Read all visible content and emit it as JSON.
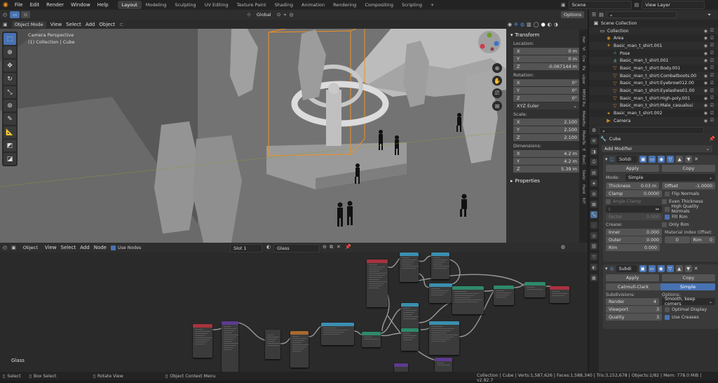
{
  "topbar": {
    "menus": [
      "File",
      "Edit",
      "Render",
      "Window",
      "Help"
    ],
    "workspaces": [
      "Layout",
      "Modeling",
      "Sculpting",
      "UV Editing",
      "Texture Paint",
      "Shading",
      "Animation",
      "Rendering",
      "Compositing",
      "Scripting"
    ],
    "active_workspace": "Layout",
    "add_tab": "+",
    "scene": "Scene",
    "view_layer": "View Layer"
  },
  "viewport_header": {
    "mode": "Object Mode",
    "menus": [
      "View",
      "Select",
      "Add",
      "Object"
    ],
    "transform_orientation": "Global",
    "options": "Options"
  },
  "viewport": {
    "camera_label": "Camera Perspective",
    "collection_label": "(1) Collection | Cube"
  },
  "n_panel": {
    "section": "Transform",
    "location_label": "Location:",
    "location": [
      {
        "axis": "X",
        "value": "0 m"
      },
      {
        "axis": "Y",
        "value": "0 m"
      },
      {
        "axis": "Z",
        "value": "-0.067144 m"
      }
    ],
    "rotation_label": "Rotation:",
    "rotation": [
      {
        "axis": "X",
        "value": "0°"
      },
      {
        "axis": "Y",
        "value": "0°"
      },
      {
        "axis": "Z",
        "value": "0°"
      }
    ],
    "rotation_mode": "XYZ Euler",
    "scale_label": "Scale:",
    "scale": [
      {
        "axis": "X",
        "value": "2.100"
      },
      {
        "axis": "Y",
        "value": "2.100"
      },
      {
        "axis": "Z",
        "value": "2.100"
      }
    ],
    "dimensions_label": "Dimensions:",
    "dimensions": [
      {
        "axis": "X",
        "value": "4.2 m"
      },
      {
        "axis": "Y",
        "value": "4.2 m"
      },
      {
        "axis": "Z",
        "value": "5.39 m"
      }
    ],
    "properties": "Properties",
    "vertical_tabs": [
      "Iter",
      "Vi",
      "Cre",
      "Pa",
      "ulpor",
      "MHX2 Ru",
      "MakeHu",
      "MakeTa",
      "E",
      "BoxC",
      "Sketc",
      "Hard",
      "KIT"
    ]
  },
  "outliner": {
    "rows": [
      {
        "name": "Scene Collection",
        "indent": 0,
        "icon": "scene-collection-icon"
      },
      {
        "name": "Collection",
        "indent": 1,
        "icon": "collection-icon"
      },
      {
        "name": "Area",
        "indent": 2,
        "icon": "light-icon"
      },
      {
        "name": "Basic_man_t_shirt.001",
        "indent": 2,
        "icon": "armature-icon"
      },
      {
        "name": "Pose",
        "indent": 3,
        "icon": "pose-icon"
      },
      {
        "name": "Basic_man_t_shirt.001",
        "indent": 3,
        "icon": "armature-data-icon"
      },
      {
        "name": "Basic_man_t_shirt:Body.001",
        "indent": 3,
        "icon": "mesh-icon"
      },
      {
        "name": "Basic_man_t_shirt:Combatboots.00",
        "indent": 3,
        "icon": "mesh-icon"
      },
      {
        "name": "Basic_man_t_shirt:Eyebrow012.00",
        "indent": 3,
        "icon": "mesh-icon"
      },
      {
        "name": "Basic_man_t_shirt:Eyelashes01.00",
        "indent": 3,
        "icon": "mesh-icon"
      },
      {
        "name": "Basic_man_t_shirt:High-poly.001",
        "indent": 3,
        "icon": "mesh-icon"
      },
      {
        "name": "Basic_man_t_shirt:Male_casualsui",
        "indent": 3,
        "icon": "mesh-icon"
      },
      {
        "name": "Basic_man_t_shirt.002",
        "indent": 2,
        "icon": "armature-icon"
      },
      {
        "name": "Camera",
        "indent": 2,
        "icon": "camera-icon"
      }
    ]
  },
  "properties": {
    "object_name": "Cube",
    "add_modifier": "Add Modifier",
    "solidify": {
      "name": "Solidi",
      "apply": "Apply",
      "copy": "Copy",
      "mode_label": "Mode:",
      "mode": "Simple",
      "thickness_label": "Thickness",
      "thickness": "0.03 m",
      "offset_label": "Offset",
      "offset": "-1.0000",
      "clamp_label": "Clamp",
      "clamp": "0.0000",
      "angle_clamp": "Angle Clamp",
      "factor_label": "Factor",
      "factor": "0.000",
      "flip_normals": "Flip Normals",
      "even_thickness": "Even Thickness",
      "high_quality_normals": "High Quality Normals",
      "fill_rim": "Fill Rim",
      "only_rim": "Only Rim",
      "crease_label": "Crease:",
      "inner_label": "Inner",
      "inner": "0.000",
      "outer_label": "Outer",
      "outer": "0.000",
      "rim_label": "Rim",
      "rim": "0.000",
      "material_offset_label": "Material Index Offset:",
      "mat_offset": "0",
      "mat_rim_label": "Rim",
      "mat_rim": "0"
    },
    "subsurf": {
      "name": "Subdi",
      "apply": "Apply",
      "copy": "Copy",
      "catmull": "Catmull-Clark",
      "simple": "Simple",
      "subdivisions_label": "Subdivisions:",
      "render_label": "Render",
      "render": "4",
      "viewport_label": "Viewport",
      "viewport": "3",
      "quality_label": "Quality",
      "quality": "3",
      "options_label": "Options:",
      "uv_smooth": "Smooth, keep corners",
      "optimal_display": "Optimal Display",
      "use_creases": "Use Creases"
    }
  },
  "node_editor": {
    "type": "Object",
    "menus": [
      "View",
      "Select",
      "Add",
      "Node"
    ],
    "use_nodes": "Use Nodes",
    "slot": "Slot 1",
    "material": "Glass",
    "material_label": "Glass"
  },
  "statusbar": {
    "select": "Select",
    "box_select": "Box Select",
    "rotate_view": "Rotate View",
    "context_menu": "Object Context Menu",
    "stats": "Collection | Cube | Verts:1,587,626 | Faces:1,588,340 | Tris:3,152,678 | Objects:1/82 | Mem: 778.0 MiB | v2.82.7"
  },
  "colors": {
    "accent": "#4772b3",
    "selection": "#334d80",
    "bg": "#1d1d1d",
    "origin_orange": "#f0901f"
  }
}
